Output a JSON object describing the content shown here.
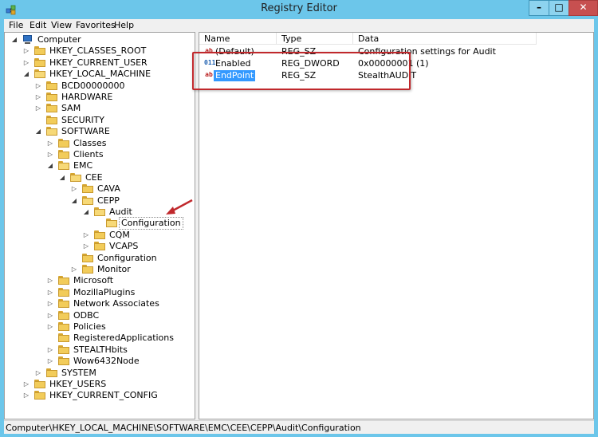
{
  "window": {
    "title": "Registry Editor"
  },
  "window_buttons": {
    "minimize": "–",
    "maximize": "□",
    "close": "✕"
  },
  "menu": [
    "File",
    "Edit",
    "View",
    "Favorites",
    "Help"
  ],
  "tree": [
    {
      "label": "Computer",
      "level": 0,
      "expander": "◢",
      "icon": "computer-icon"
    },
    {
      "label": "HKEY_CLASSES_ROOT",
      "level": 1,
      "expander": "▷"
    },
    {
      "label": "HKEY_CURRENT_USER",
      "level": 1,
      "expander": "▷"
    },
    {
      "label": "HKEY_LOCAL_MACHINE",
      "level": 1,
      "expander": "◢"
    },
    {
      "label": "BCD00000000",
      "level": 2,
      "expander": "▷"
    },
    {
      "label": "HARDWARE",
      "level": 2,
      "expander": "▷"
    },
    {
      "label": "SAM",
      "level": 2,
      "expander": "▷"
    },
    {
      "label": "SECURITY",
      "level": 2,
      "expander": ""
    },
    {
      "label": "SOFTWARE",
      "level": 2,
      "expander": "◢"
    },
    {
      "label": "Classes",
      "level": 3,
      "expander": "▷"
    },
    {
      "label": "Clients",
      "level": 3,
      "expander": "▷"
    },
    {
      "label": "EMC",
      "level": 3,
      "expander": "◢"
    },
    {
      "label": "CEE",
      "level": 4,
      "expander": "◢"
    },
    {
      "label": "CAVA",
      "level": 5,
      "expander": "▷"
    },
    {
      "label": "CEPP",
      "level": 5,
      "expander": "◢"
    },
    {
      "label": "Audit",
      "level": 6,
      "expander": "◢"
    },
    {
      "label": "Configuration",
      "level": 7,
      "expander": "",
      "selected": true
    },
    {
      "label": "CQM",
      "level": 6,
      "expander": "▷"
    },
    {
      "label": "VCAPS",
      "level": 6,
      "expander": "▷"
    },
    {
      "label": "Configuration",
      "level": 5,
      "expander": ""
    },
    {
      "label": "Monitor",
      "level": 5,
      "expander": "▷"
    },
    {
      "label": "Microsoft",
      "level": 3,
      "expander": "▷"
    },
    {
      "label": "MozillaPlugins",
      "level": 3,
      "expander": "▷"
    },
    {
      "label": "Network Associates",
      "level": 3,
      "expander": "▷"
    },
    {
      "label": "ODBC",
      "level": 3,
      "expander": "▷"
    },
    {
      "label": "Policies",
      "level": 3,
      "expander": "▷"
    },
    {
      "label": "RegisteredApplications",
      "level": 3,
      "expander": ""
    },
    {
      "label": "STEALTHbits",
      "level": 3,
      "expander": "▷"
    },
    {
      "label": "Wow6432Node",
      "level": 3,
      "expander": "▷"
    },
    {
      "label": "SYSTEM",
      "level": 2,
      "expander": "▷"
    },
    {
      "label": "HKEY_USERS",
      "level": 1,
      "expander": "▷"
    },
    {
      "label": "HKEY_CURRENT_CONFIG",
      "level": 1,
      "expander": "▷"
    }
  ],
  "columns": [
    "Name",
    "Type",
    "Data"
  ],
  "values": [
    {
      "icon": "ab",
      "name": "(Default)",
      "type": "REG_SZ",
      "data": "Configuration settings for Audit",
      "selected": false
    },
    {
      "icon": "011",
      "name": "Enabled",
      "type": "REG_DWORD",
      "data": "0x00000001 (1)",
      "selected": false
    },
    {
      "icon": "ab",
      "name": "EndPoint",
      "type": "REG_SZ",
      "data": "StealthAUDIT",
      "selected": true
    }
  ],
  "status": {
    "path": "Computer\\HKEY_LOCAL_MACHINE\\SOFTWARE\\EMC\\CEE\\CEPP\\Audit\\Configuration"
  },
  "colors": {
    "highlight_box": "#c0282c",
    "selection": "#3399ff",
    "titlebar": "#6cc6ea"
  }
}
